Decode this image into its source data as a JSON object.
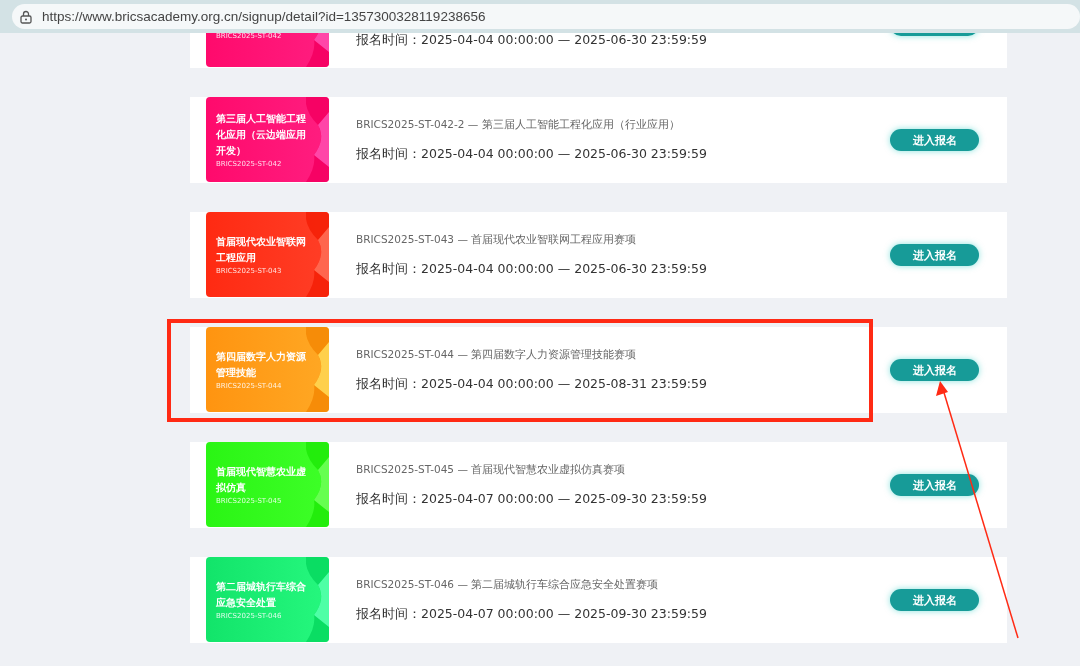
{
  "browser": {
    "url": "https://www.bricsacademy.org.cn/signup/detail?id=1357300328119238656"
  },
  "events": [
    {
      "thumb_code": "BRICS2025-ST-042",
      "time": "报名时间：2025-04-04 00:00:00 — 2025-06-30 23:59:59",
      "color": "#ff0a6c",
      "highlighted": false
    },
    {
      "thumb_title": "第三届人工智能工程化应用（云边端应用开发）",
      "thumb_code": "BRICS2025-ST-042",
      "description": "BRICS2025-ST-042-2 — 第三届人工智能工程化应用（行业应用）",
      "time": "报名时间：2025-04-04 00:00:00 — 2025-06-30 23:59:59",
      "button": "进入报名",
      "color": "#ff0a6c",
      "highlighted": false
    },
    {
      "thumb_title": "首届现代农业智联网工程应用",
      "thumb_code": "BRICS2025-ST-043",
      "description": "BRICS2025-ST-043 — 首届现代农业智联网工程应用赛项",
      "time": "报名时间：2025-04-04 00:00:00 — 2025-06-30 23:59:59",
      "button": "进入报名",
      "color": "#ff2a12",
      "highlighted": false
    },
    {
      "thumb_title": "第四届数字人力资源管理技能",
      "thumb_code": "BRICS2025-ST-044",
      "description": "BRICS2025-ST-044 — 第四届数字人力资源管理技能赛项",
      "time": "报名时间：2025-04-04 00:00:00 — 2025-08-31 23:59:59",
      "button": "进入报名",
      "color": "#ff9410",
      "highlighted": true
    },
    {
      "thumb_title": "首届现代智慧农业虚拟仿真",
      "thumb_code": "BRICS2025-ST-045",
      "description": "BRICS2025-ST-045 — 首届现代智慧农业虚拟仿真赛项",
      "time": "报名时间：2025-04-07 00:00:00 — 2025-09-30 23:59:59",
      "button": "进入报名",
      "color": "#2af514",
      "highlighted": false
    },
    {
      "thumb_title": "第二届城轨行车综合应急安全处置",
      "thumb_code": "BRICS2025-ST-046",
      "description": "BRICS2025-ST-046 — 第二届城轨行车综合应急安全处置赛项",
      "time": "报名时间：2025-04-07 00:00:00 — 2025-09-30 23:59:59",
      "button": "进入报名",
      "color": "#12e46a",
      "highlighted": false
    }
  ]
}
